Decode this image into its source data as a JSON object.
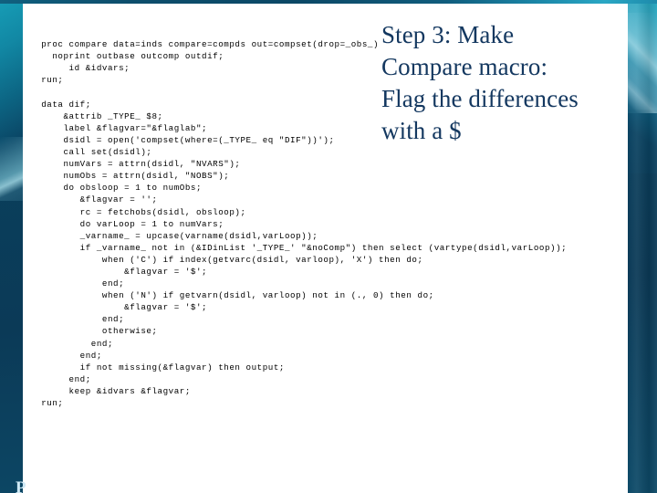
{
  "slide": {
    "title": "Step 3: Make\nCompare macro:\nFlag the differences\nwith a $",
    "footer_text": "P",
    "code": "   proc compare data=inds compare=compds out=compset(drop=_obs_)\n     noprint outbase outcomp outdif;\n        id &idvars;\n   run;\n\n   data dif;\n       &attrib _TYPE_ $8;\n       label &flagvar=\"&flaglab\";\n       dsidl = open('compset(where=(_TYPE_ eq \"DIF\"))');\n       call set(dsidl);\n       numVars = attrn(dsidl, \"NVARS\");\n       numObs = attrn(dsidl, \"NOBS\");\n       do obsloop = 1 to numObs;\n          &flagvar = '';\n          rc = fetchobs(dsidl, obsloop);\n          do varLoop = 1 to numVars;\n          _varname_ = upcase(varname(dsidl,varLoop));\n          if _varname_ not in (&IDinList '_TYPE_' \"&noComp\") then select (vartype(dsidl,varLoop));\n              when ('C') if index(getvarc(dsidl, varloop), 'X') then do;\n                  &flagvar = '$';\n              end;\n              when ('N') if getvarn(dsidl, varloop) not in (., 0) then do;\n                  &flagvar = '$';\n              end;\n              otherwise;\n            end;\n          end;\n          if not missing(&flagvar) then output;\n        end;\n        keep &idvars &flagvar;\n   run;",
    "colors": {
      "title_text": "#143860",
      "code_text": "#000000",
      "page_background": "#ffffff",
      "frame_navy": "#0b3a57",
      "frame_teal": "#1ca7c4",
      "footer_text": "#cfe9f5"
    }
  }
}
